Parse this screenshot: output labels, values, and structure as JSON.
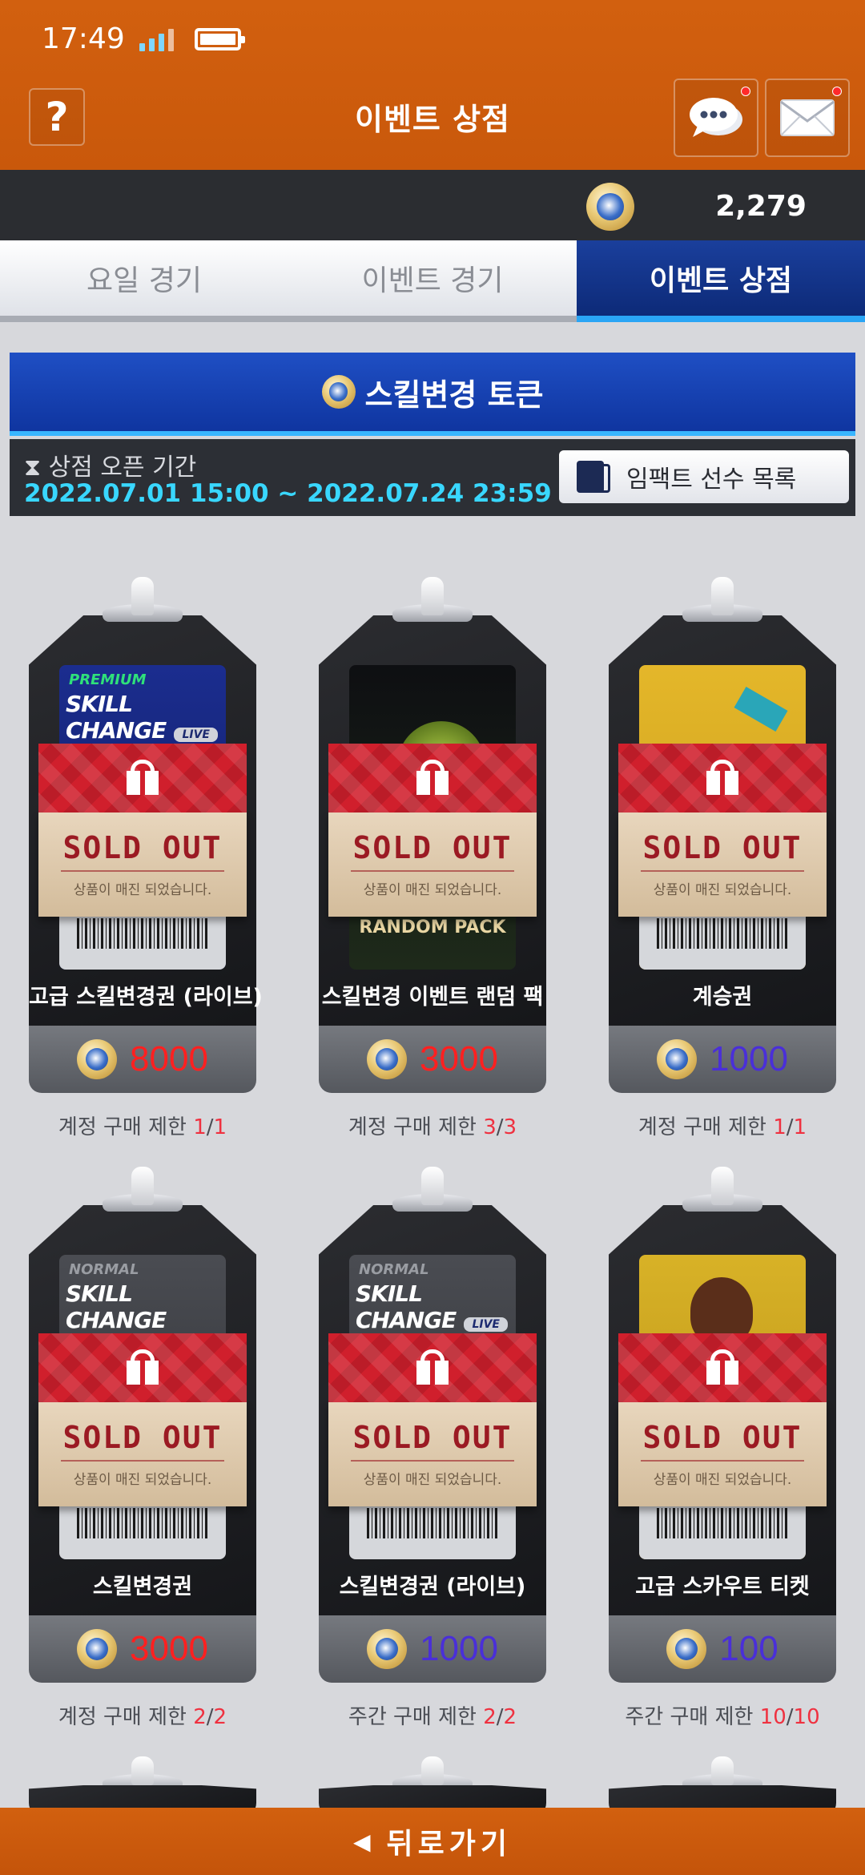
{
  "status": {
    "time": "17:49"
  },
  "header": {
    "title": "이벤트 상점",
    "help_label": "?"
  },
  "currency": {
    "amount": "2,279"
  },
  "tabs": [
    {
      "label": "요일 경기",
      "active": false
    },
    {
      "label": "이벤트 경기",
      "active": false
    },
    {
      "label": "이벤트 상점",
      "active": true
    }
  ],
  "section": {
    "title": "스킬변경 토큰",
    "period_label": "상점 오픈 기간",
    "period_dates": "2022.07.01 15:00 ~ 2022.07.24 23:59",
    "impact_button": "임팩트 선수 목록"
  },
  "sold_out": {
    "title": "SOLD OUT",
    "subtitle": "상품이 매진 되었습니다."
  },
  "art_text": {
    "premium": "PREMIUM",
    "normal": "NORMAL",
    "skill_change": "SKILL CHANGE",
    "live": "LIVE",
    "random_pack": "RANDOM PACK"
  },
  "items": [
    {
      "name": "고급 스킬변경권 (라이브)",
      "price": "8000",
      "price_color": "#ff2020",
      "limit_label": "계정 구매 제한",
      "limit_used": "1",
      "limit_max": "1"
    },
    {
      "name": "스킬변경 이벤트 랜덤 팩",
      "price": "3000",
      "price_color": "#ff2020",
      "limit_label": "계정 구매 제한",
      "limit_used": "3",
      "limit_max": "3"
    },
    {
      "name": "계승권",
      "price": "1000",
      "price_color": "#4a2fd8",
      "limit_label": "계정 구매 제한",
      "limit_used": "1",
      "limit_max": "1"
    },
    {
      "name": "스킬변경권",
      "price": "3000",
      "price_color": "#ff2020",
      "limit_label": "계정 구매 제한",
      "limit_used": "2",
      "limit_max": "2"
    },
    {
      "name": "스킬변경권 (라이브)",
      "price": "1000",
      "price_color": "#4a2fd8",
      "limit_label": "주간 구매 제한",
      "limit_used": "2",
      "limit_max": "2"
    },
    {
      "name": "고급 스카우트 티켓",
      "price": "100",
      "price_color": "#4a2fd8",
      "limit_label": "주간 구매 제한",
      "limit_used": "10",
      "limit_max": "10"
    }
  ],
  "footer": {
    "back_label": "뒤로가기"
  },
  "icons": [
    "signal-icon",
    "battery-icon",
    "help-icon",
    "chat-icon",
    "mail-icon",
    "coin-icon",
    "hourglass-icon",
    "card-icon",
    "gift-icon",
    "back-arrow-icon"
  ]
}
